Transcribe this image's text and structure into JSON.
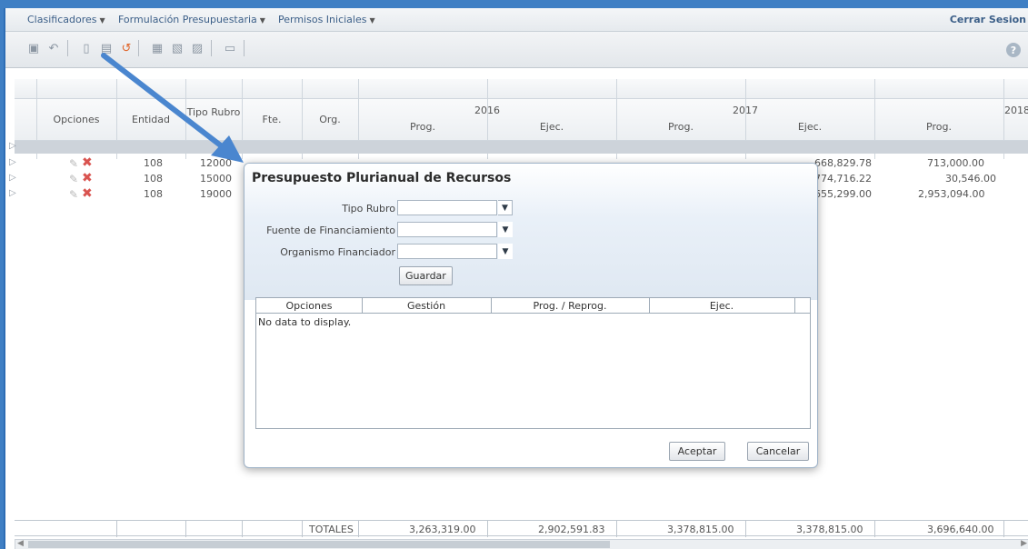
{
  "menu": {
    "items": [
      {
        "label": "Clasificadores"
      },
      {
        "label": "Formulación Presupuestaria"
      },
      {
        "label": "Permisos Iniciales"
      }
    ],
    "logout_label": "Cerrar Sesion"
  },
  "toolbar": {
    "icons": [
      "print-preview-icon",
      "undo-icon",
      "new-document-icon",
      "save-icon",
      "refresh-icon",
      "print-icon",
      "export-pdf-icon",
      "export-excel-icon",
      "view-icon",
      "help-icon"
    ],
    "help_label": "?"
  },
  "grid": {
    "headers": {
      "opciones": "Opciones",
      "entidad": "Entidad",
      "tipo_rubro": "Tipo Rubro",
      "fte": "Fte.",
      "org": "Org.",
      "years": [
        "2016",
        "2017",
        "2018"
      ],
      "prog": "Prog.",
      "ejec": "Ejec."
    },
    "rows": [
      {
        "entidad": "108",
        "tipo": "12000",
        "ejec_2017": "668,829.78",
        "prog_2018": "713,000.00"
      },
      {
        "entidad": "108",
        "tipo": "15000",
        "ejec_2017": "774,716.22",
        "prog_2018": "30,546.00"
      },
      {
        "entidad": "108",
        "tipo": "19000",
        "ejec_2017": "655,299.00",
        "prog_2018": "2,953,094.00"
      }
    ],
    "totals": {
      "label": "TOTALES",
      "prog_2016": "3,263,319.00",
      "ejec_2016": "2,902,591.83",
      "prog_2017": "3,378,815.00",
      "ejec_2017": "3,378,815.00",
      "prog_2018": "3,696,640.00"
    }
  },
  "dialog": {
    "title": "Presupuesto Plurianual de Recursos",
    "fields": {
      "tipo_rubro": {
        "label": "Tipo Rubro",
        "value": ""
      },
      "fuente": {
        "label": "Fuente de Financiamiento",
        "value": ""
      },
      "organismo": {
        "label": "Organismo Financiador",
        "value": ""
      }
    },
    "save_label": "Guardar",
    "table": {
      "headers": [
        "Opciones",
        "Gestión",
        "Prog. / Reprog.",
        "Ejec."
      ],
      "empty_text": "No data to display."
    },
    "accept_label": "Aceptar",
    "cancel_label": "Cancelar"
  },
  "colors": {
    "frame_blue": "#3f7fc4",
    "arrow_blue": "#4a86cf",
    "delete_red": "#d9534f"
  }
}
